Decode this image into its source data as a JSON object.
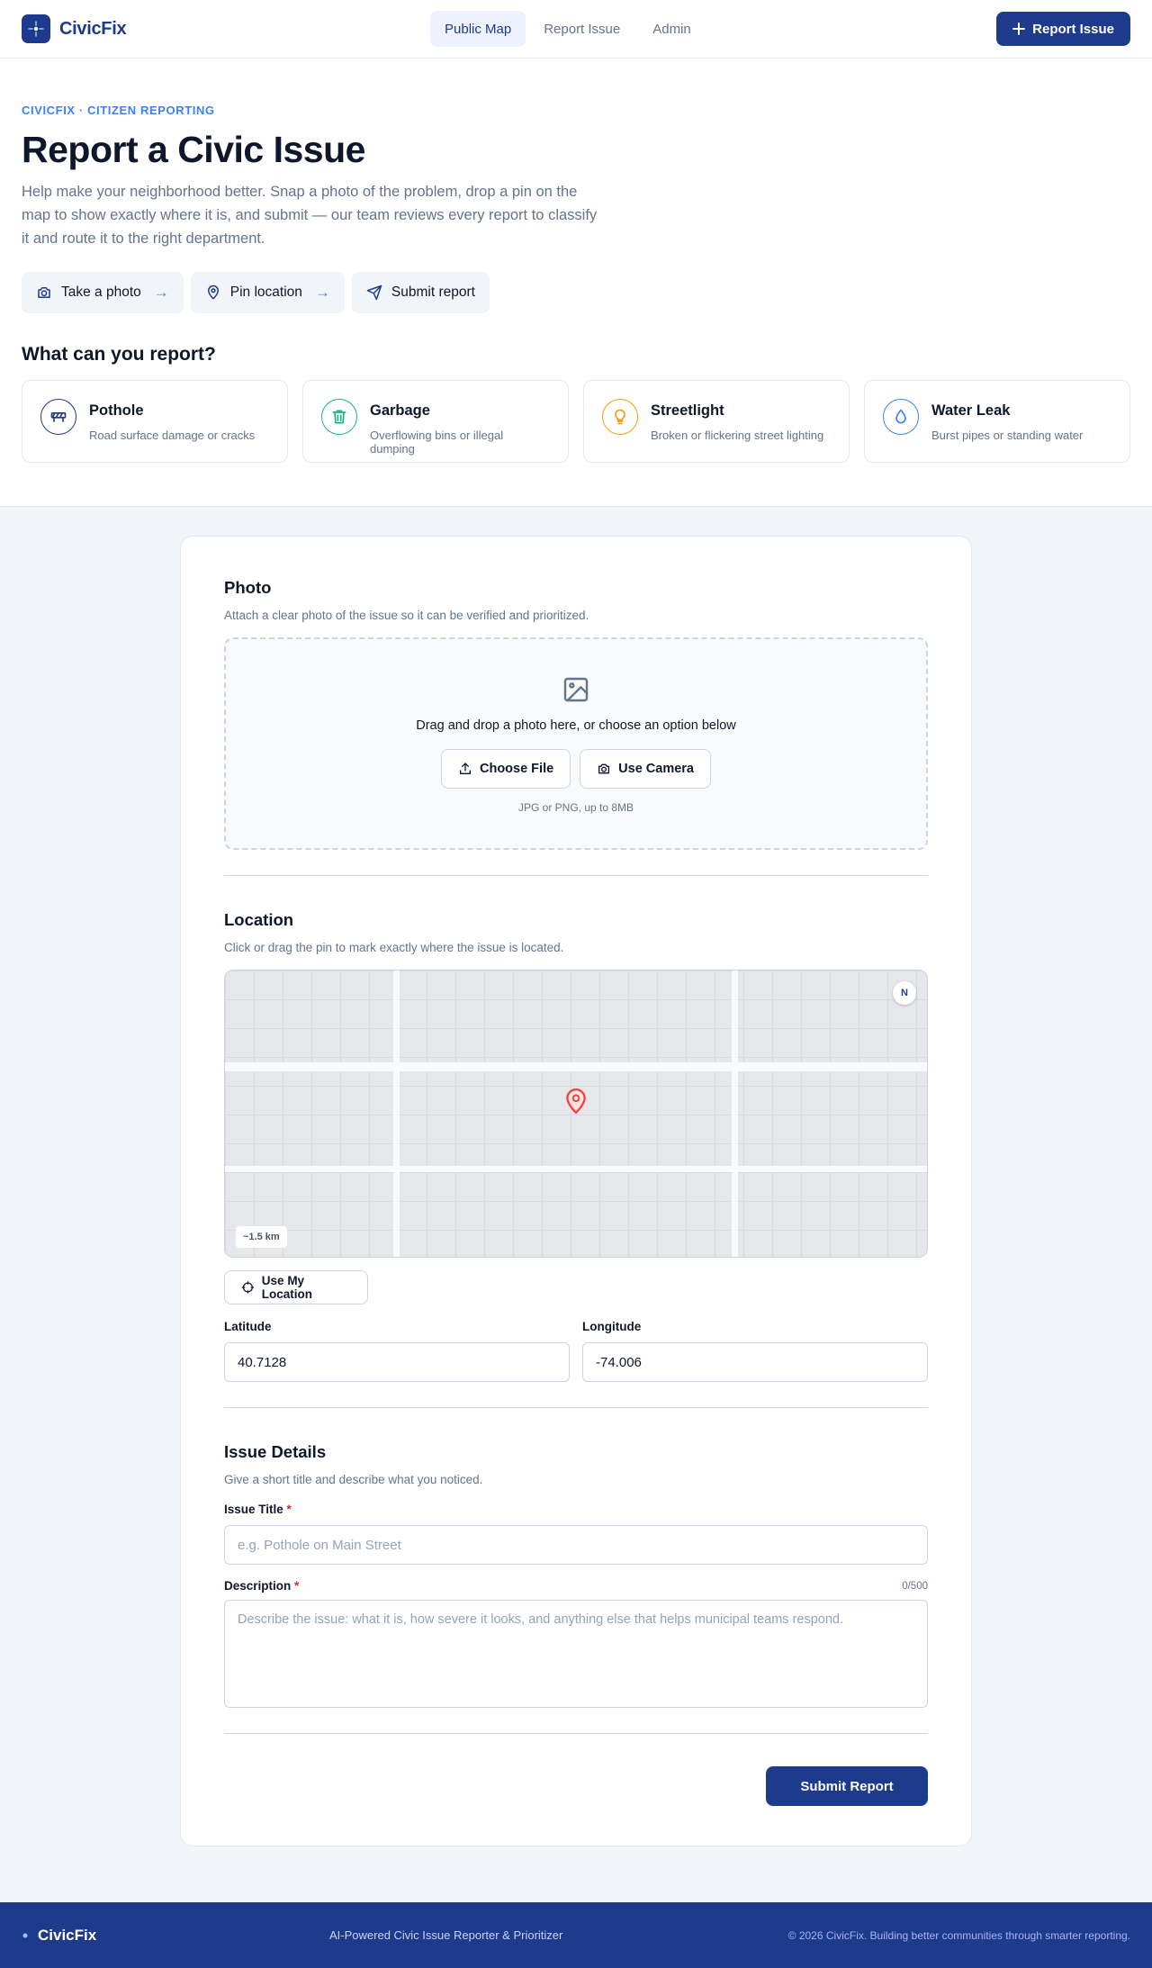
{
  "nav": {
    "brand": "CivicFix",
    "links": [
      "Public Map",
      "Report Issue",
      "Admin"
    ],
    "cta": "Report Issue"
  },
  "hero": {
    "eyebrow": "CIVICFIX · CITIZEN REPORTING",
    "title": "Report a Civic Issue",
    "subtitle": "Help make your neighborhood better. Snap a photo of the problem, drop a pin on the map to show exactly where it is, and submit — our team reviews every report to classify it and route it to the right department.",
    "steps": [
      "Take a photo",
      "Pin location",
      "Submit report"
    ],
    "step_arrow": "→"
  },
  "categories": {
    "title": "What can you report?",
    "items": [
      {
        "name": "Pothole",
        "desc": "Road surface damage or cracks",
        "color": "#1e3a8a",
        "icon": "road-barrier-icon"
      },
      {
        "name": "Garbage",
        "desc": "Overflowing bins or illegal dumping",
        "color": "#10b981",
        "icon": "trash-icon"
      },
      {
        "name": "Streetlight",
        "desc": "Broken or flickering street lighting",
        "color": "#f59e0b",
        "icon": "lightbulb-icon"
      },
      {
        "name": "Water Leak",
        "desc": "Burst pipes or standing water",
        "color": "#3b82f6",
        "icon": "droplet-icon"
      }
    ]
  },
  "photo": {
    "title": "Photo",
    "subtitle": "Attach a clear photo of the issue so it can be verified and prioritized.",
    "drop_text": "Drag and drop a photo here, or choose an option below",
    "choose_file": "Choose File",
    "use_camera": "Use Camera",
    "hint": "JPG or PNG, up to 8MB"
  },
  "location": {
    "title": "Location",
    "subtitle": "Click or drag the pin to mark exactly where the issue is located.",
    "compass": "N",
    "scale": "~1.5 km",
    "use_location": "Use My Location",
    "latitude_label": "Latitude",
    "latitude_value": "40.7128",
    "longitude_label": "Longitude",
    "longitude_value": "-74.006"
  },
  "details": {
    "title": "Issue Details",
    "subtitle": "Give a short title and describe what you noticed.",
    "title_label": "Issue Title",
    "title_placeholder": "e.g. Pothole on Main Street",
    "required_mark": "*",
    "desc_label": "Description",
    "desc_placeholder": "Describe the issue: what it is, how severe it looks, and anything else that helps municipal teams respond.",
    "counter": "0/500"
  },
  "submit": "Submit Report",
  "footer": {
    "brand": "CivicFix",
    "tagline": "AI-Powered Civic Issue Reporter & Prioritizer",
    "copyright": "© 2026 CivicFix. Building better communities through smarter reporting."
  },
  "colors": {
    "primary": "#1e3a8a",
    "accent": "#3b82f6",
    "pin": "#ef4444"
  }
}
